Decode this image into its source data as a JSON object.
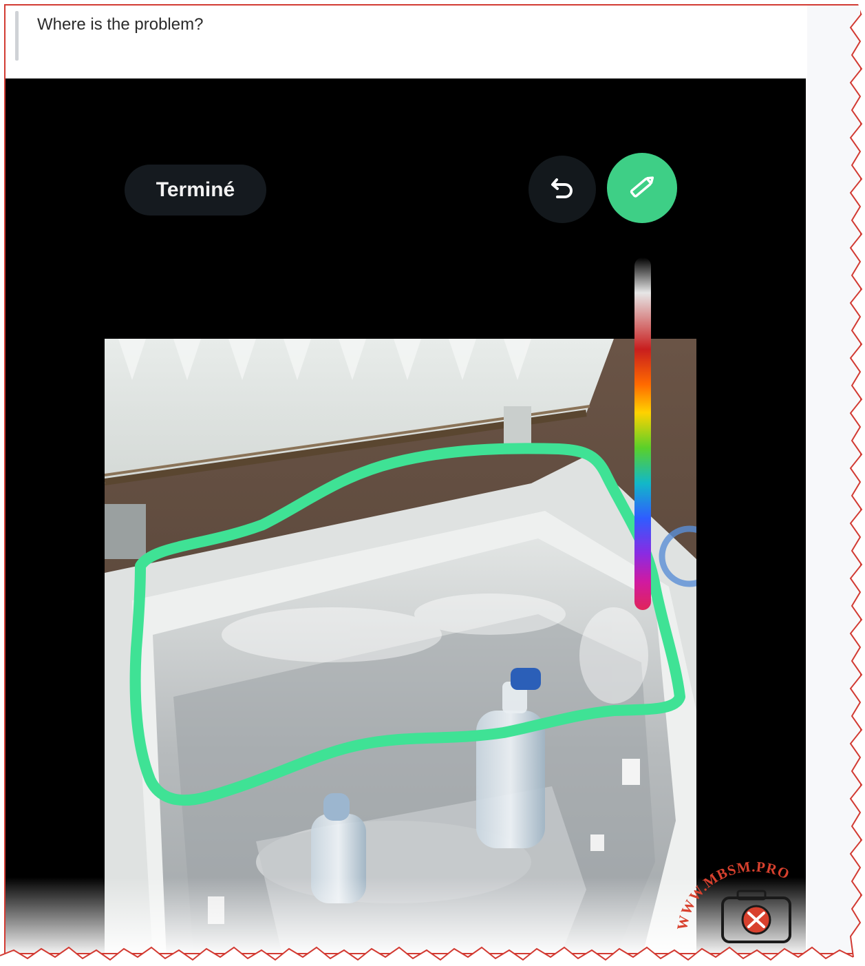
{
  "prompt": {
    "question": "Where is the problem?"
  },
  "toolbar": {
    "done_label": "Terminé",
    "undo_icon": "undo-icon",
    "pen_icon": "pencil-icon"
  },
  "colors": {
    "pen": "#3ecf86",
    "frame_border": "#d23a32",
    "editor_background": "#000000"
  },
  "watermark": {
    "text": "WWW.MBSM.PRO"
  }
}
